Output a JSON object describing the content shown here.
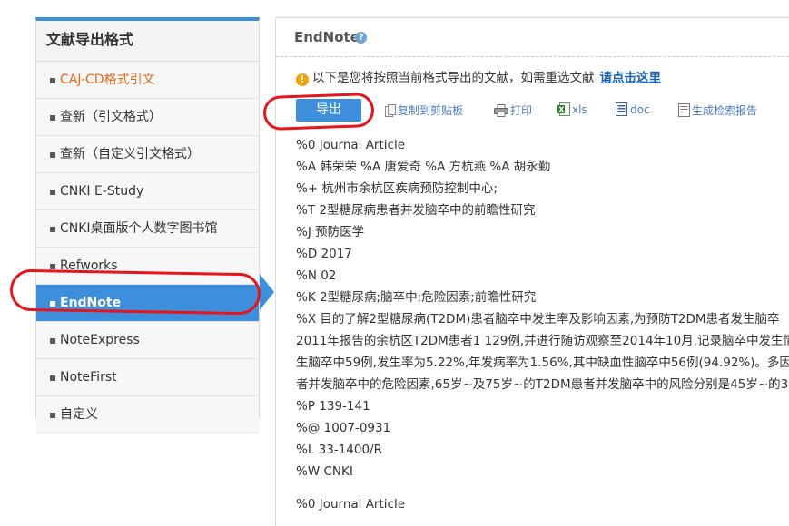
{
  "sidebar": {
    "title": "文献导出格式",
    "items": [
      {
        "label": "CAJ-CD格式引文"
      },
      {
        "label": "查新（引文格式）"
      },
      {
        "label": "查新（自定义引文格式）"
      },
      {
        "label": "CNKI E-Study"
      },
      {
        "label": "CNKI桌面版个人数字图书馆"
      },
      {
        "label": "Refworks"
      },
      {
        "label": "EndNote"
      },
      {
        "label": "NoteExpress"
      },
      {
        "label": "NoteFirst"
      },
      {
        "label": "自定义"
      }
    ]
  },
  "main": {
    "title": "EndNote",
    "notice_text": "以下是您将按照当前格式导出的文献，如需重选文献",
    "notice_link": "请点击这里",
    "toolbar": {
      "export": "导出",
      "copy": "复制到剪贴板",
      "print": "打印",
      "xls": "xls",
      "doc": "doc",
      "report": "生成检索报告"
    },
    "records": [
      "%0 Journal Article",
      "%A 韩荣荣 %A 唐爱奇 %A 方杭燕 %A 胡永勤",
      "%+ 杭州市余杭区疾病预防控制中心;",
      "%T 2型糖尿病患者并发脑卒中的前瞻性研究",
      "%J 预防医学",
      "%D 2017",
      "%N 02",
      "%K 2型糖尿病;脑卒中;危险因素;前瞻性研究",
      "%X 目的了解2型糖尿病(T2DM)患者脑卒中发生率及影响因素,为预防T2DM患者发生脑卒",
      "2011年报告的余杭区T2DM患者1 129例,并进行随访观察至2014年10月,记录脑卒中发生情",
      "生脑卒中59例,发生率为5.22%,年发病率为1.56%,其中缺血性脑卒中56例(94.92%)。多因",
      "者并发脑卒中的危险因素,65岁~及75岁~的T2DM患者并发脑卒中的风险分别是45岁~的3",
      "%P 139-141",
      "%@ 1007-0931",
      "%L 33-1400/R",
      "%W CNKI"
    ],
    "next_record_first_line": "%0 Journal Article"
  },
  "colors": {
    "accent": "#3d8fdc",
    "highlight_orange": "#e56a1a",
    "annotation_red": "#e8141a",
    "link": "#1a5fb4"
  }
}
